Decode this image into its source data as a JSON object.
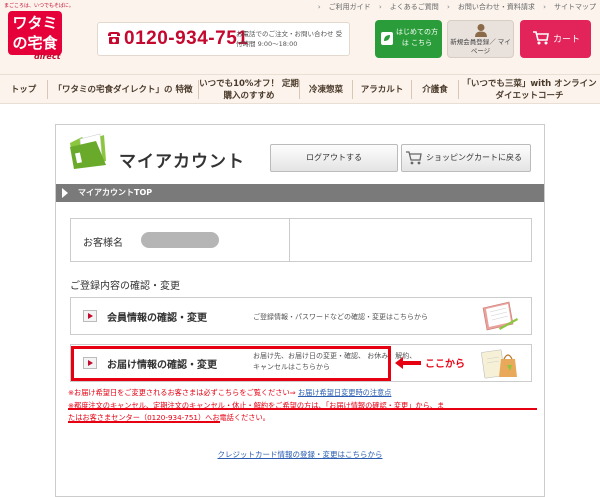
{
  "header": {
    "logo_tagline": "まごころは、いつでもそばに。",
    "logo_text": "ワタミの宅食",
    "logo_sub": "direct",
    "top_links": [
      "ご利用ガイド",
      "よくあるご質問",
      "お問い合わせ・資料請求",
      "サイトマップ"
    ],
    "phone": "0120-934-751",
    "phone_note": "お電話でのご注文・お問い合わせ 受付時間 9:00～18:00",
    "first_time_button": "はじめての方は こちら",
    "member_button": "新規会員登録／ マイページ",
    "cart_button": "カート"
  },
  "nav": {
    "items": [
      "トップ",
      "「ワタミの宅食ダイレクト」の 特徴",
      "いつでも10%オフ！ 定期購入のすすめ",
      "冷凍惣菜",
      "アラカルト",
      "介護食",
      "「いつでも三菜」with オンラインダイエットコーチ"
    ]
  },
  "main": {
    "title": "マイアカウント",
    "logout_button": "ログアウトする",
    "back_to_cart_button": "ショッピングカートに戻る",
    "breadcrumb": "マイアカウントTOP",
    "customer_label": "お客様名",
    "section_title": "ご登録内容の確認・変更",
    "rows": [
      {
        "title": "会員情報の確認・変更",
        "desc": "ご登録情報・パスワードなどの確認・変更はこちらから"
      },
      {
        "title": "お届け情報の確認・変更",
        "desc": "お届け先、お届け日の変更・確認、 お休み、解約、キャンセルはこちらから"
      }
    ],
    "callout": "ここから",
    "notes": {
      "line1_prefix": "※お届け希望日をご変更されるお客さまは必ずこちらをご覧ください⇒ ",
      "line1_link": "お届け希望日変更時の注意点",
      "line2_prefix": "※都度注文のキャンセル、",
      "line2_underlined": "定期注文のキャンセル・休止・解約をご希望の方は、「お届け情報の確認・変更」から、ま",
      "line3_underlined": "たはお客さまセンター（0120-934-751）へお電話ください。"
    },
    "credit_link": "クレジットカード情報の登録・変更はこちらから"
  },
  "colors": {
    "brand_red": "#e60039",
    "header_bg": "#fbf3ec",
    "green": "#2a9d3a",
    "cart_pink": "#e2245a",
    "link_blue": "#2a5db0"
  }
}
